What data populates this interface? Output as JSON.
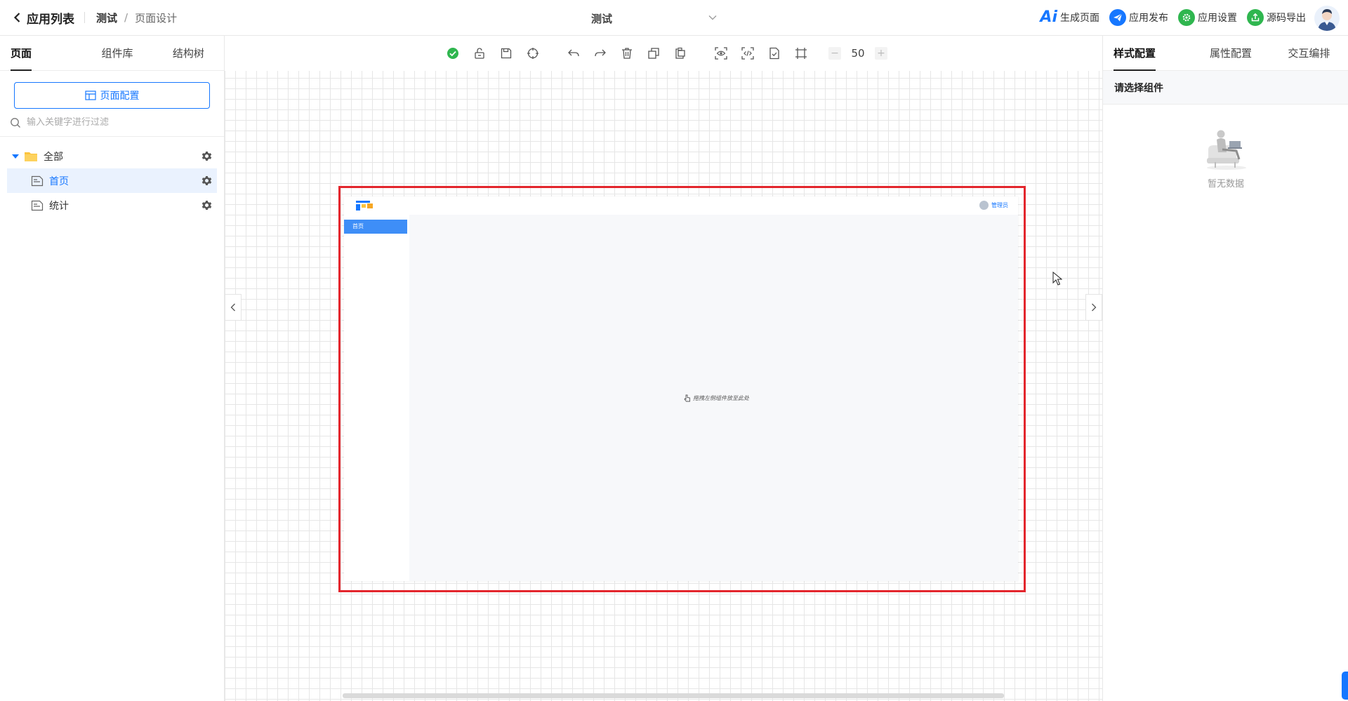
{
  "header": {
    "back_label": "应用列表",
    "app_name": "测试",
    "separator": "/",
    "page_name": "页面设计",
    "app_select_value": "测试",
    "actions": [
      {
        "label": "生成页面",
        "icon": "ai-icon"
      },
      {
        "label": "应用发布",
        "icon": "send-icon"
      },
      {
        "label": "应用设置",
        "icon": "settings-icon"
      },
      {
        "label": "源码导出",
        "icon": "export-icon"
      }
    ]
  },
  "left_panel": {
    "tabs": [
      "页面",
      "组件库",
      "结构树"
    ],
    "active_tab": "页面",
    "config_button": "页面配置",
    "search_placeholder": "输入关键字进行过滤",
    "tree": {
      "root": "全部",
      "pages": [
        "首页",
        "统计"
      ],
      "selected": "首页"
    }
  },
  "toolbar": {
    "zoom": "50",
    "zoom_minus": "−",
    "zoom_plus": "+"
  },
  "preview": {
    "user_name": "管理员",
    "nav_item": "首页",
    "drop_hint": "拖拽左侧组件放至此处"
  },
  "right_panel": {
    "tabs": [
      "样式配置",
      "属性配置",
      "交互编排"
    ],
    "active_tab": "样式配置",
    "select_tip": "请选择组件",
    "empty_text": "暂无数据"
  },
  "colors": {
    "primary": "#1677ff",
    "frame": "#e3262d",
    "success": "#2fb64f",
    "nav": "#3e8ef7"
  }
}
